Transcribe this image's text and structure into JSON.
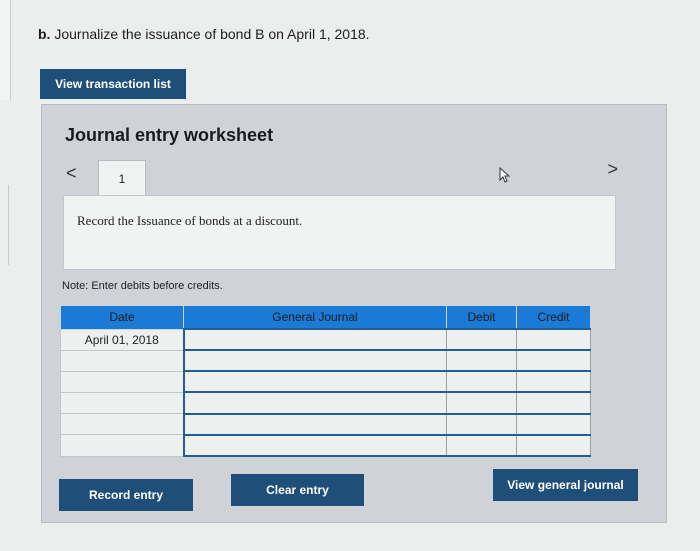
{
  "question": {
    "prefix": "b.",
    "text": "Journalize the issuance of bond B on April 1, 2018."
  },
  "buttons": {
    "view_transaction_list": "View transaction list",
    "record_entry": "Record entry",
    "clear_entry": "Clear entry",
    "view_general_journal": "View general journal"
  },
  "worksheet": {
    "title": "Journal entry worksheet",
    "nav_prev": "<",
    "nav_next": ">",
    "tab_label": "1",
    "description": "Record the Issuance of bonds at a discount.",
    "note": "Note: Enter debits before credits."
  },
  "table": {
    "headers": [
      "Date",
      "General Journal",
      "Debit",
      "Credit"
    ],
    "rows": [
      {
        "date": "April 01, 2018",
        "journal": "",
        "debit": "",
        "credit": ""
      },
      {
        "date": "",
        "journal": "",
        "debit": "",
        "credit": ""
      },
      {
        "date": "",
        "journal": "",
        "debit": "",
        "credit": ""
      },
      {
        "date": "",
        "journal": "",
        "debit": "",
        "credit": ""
      },
      {
        "date": "",
        "journal": "",
        "debit": "",
        "credit": ""
      },
      {
        "date": "",
        "journal": "",
        "debit": "",
        "credit": ""
      }
    ]
  },
  "colors": {
    "button_bg": "#1f4e79",
    "table_header": "#1a7ad6",
    "row_border": "#1f5e97"
  }
}
